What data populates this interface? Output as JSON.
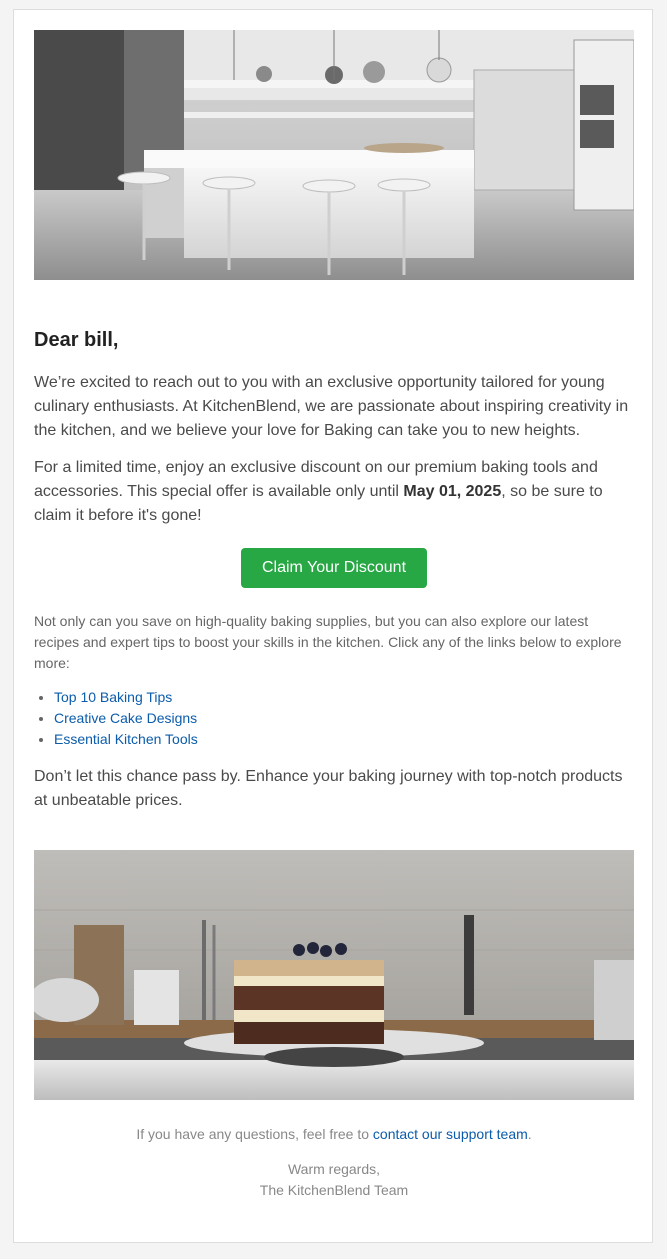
{
  "greeting": "Dear bill,",
  "intro": "We’re excited to reach out to you with an exclusive opportunity tailored for young culinary enthusiasts. At KitchenBlend, we are passionate about inspiring creativity in the kitchen, and we believe your love for Baking can take you to new heights.",
  "offer": {
    "before": "For a limited time, enjoy an exclusive discount on our premium baking tools and accessories. This special offer is available only until ",
    "date": "May 01, 2025",
    "after": ", so be sure to claim it before it's gone!"
  },
  "cta_label": "Claim Your Discount",
  "explore_text": "Not only can you save on high-quality baking supplies, but you can also explore our latest recipes and expert tips to boost your skills in the kitchen. Click any of the links below to explore more:",
  "links": [
    "Top 10 Baking Tips",
    "Creative Cake Designs",
    "Essential Kitchen Tools"
  ],
  "closing": "Don’t let this chance pass by. Enhance your baking journey with top-notch products at unbeatable prices.",
  "footer": {
    "question_before": "If you have any questions, feel free to ",
    "support_link": "contact our support team",
    "question_after": ".",
    "regards": "Warm regards,",
    "team": "The KitchenBlend Team"
  },
  "colors": {
    "cta": "#28a745",
    "link": "#0b5cab"
  }
}
